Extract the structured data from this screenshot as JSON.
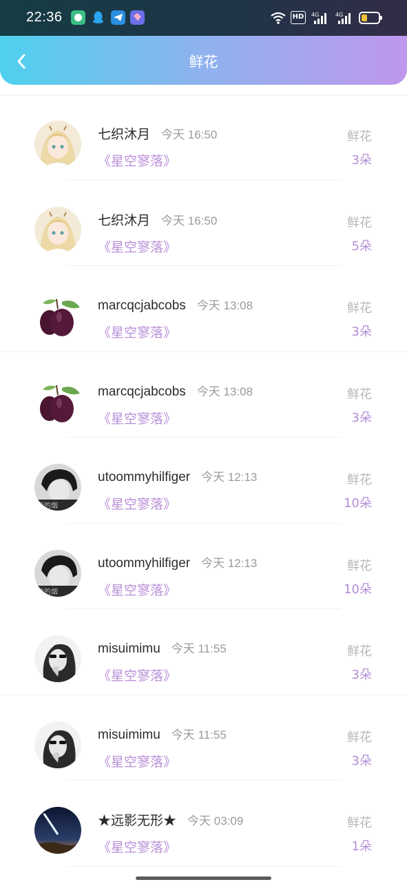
{
  "status_bar": {
    "time": "22:36",
    "hd_label": "HD",
    "net1": "4G",
    "net2": "4G"
  },
  "header": {
    "title": "鲜花",
    "back_icon": "chevron-left-icon"
  },
  "colors": {
    "gradient_start": "#4fd0ee",
    "gradient_end": "#bf97ec",
    "song_color": "#b98ed8",
    "count_color": "#b48fd7"
  },
  "items": [
    {
      "user": "七织沐月",
      "time": "今天 16:50",
      "song": "《星空寥落》",
      "label": "鲜花",
      "count": "3朵",
      "avatar": "anime-girl"
    },
    {
      "user": "七织沐月",
      "time": "今天 16:50",
      "song": "《星空寥落》",
      "label": "鲜花",
      "count": "5朵",
      "avatar": "anime-girl"
    },
    {
      "user": "marcqcjabcobs",
      "time": "今天 13:08",
      "song": "《星空寥落》",
      "label": "鲜花",
      "count": "3朵",
      "avatar": "plum"
    },
    {
      "user": "marcqcjabcobs",
      "time": "今天 13:08",
      "song": "《星空寥落》",
      "label": "鲜花",
      "count": "3朵",
      "avatar": "plum"
    },
    {
      "user": "utoommyhilfiger",
      "time": "今天 12:13",
      "song": "《星空寥落》",
      "label": "鲜花",
      "count": "10朵",
      "avatar": "bw-boy"
    },
    {
      "user": "utoommyhilfiger",
      "time": "今天 12:13",
      "song": "《星空寥落》",
      "label": "鲜花",
      "count": "10朵",
      "avatar": "bw-boy"
    },
    {
      "user": "misuimimu",
      "time": "今天 11:55",
      "song": "《星空寥落》",
      "label": "鲜花",
      "count": "3朵",
      "avatar": "bw-girl"
    },
    {
      "user": "misuimimu",
      "time": "今天 11:55",
      "song": "《星空寥落》",
      "label": "鲜花",
      "count": "3朵",
      "avatar": "bw-girl"
    },
    {
      "user": "★远影无形★",
      "time": "今天 03:09",
      "song": "《星空寥落》",
      "label": "鲜花",
      "count": "1朵",
      "avatar": "meteor"
    }
  ]
}
